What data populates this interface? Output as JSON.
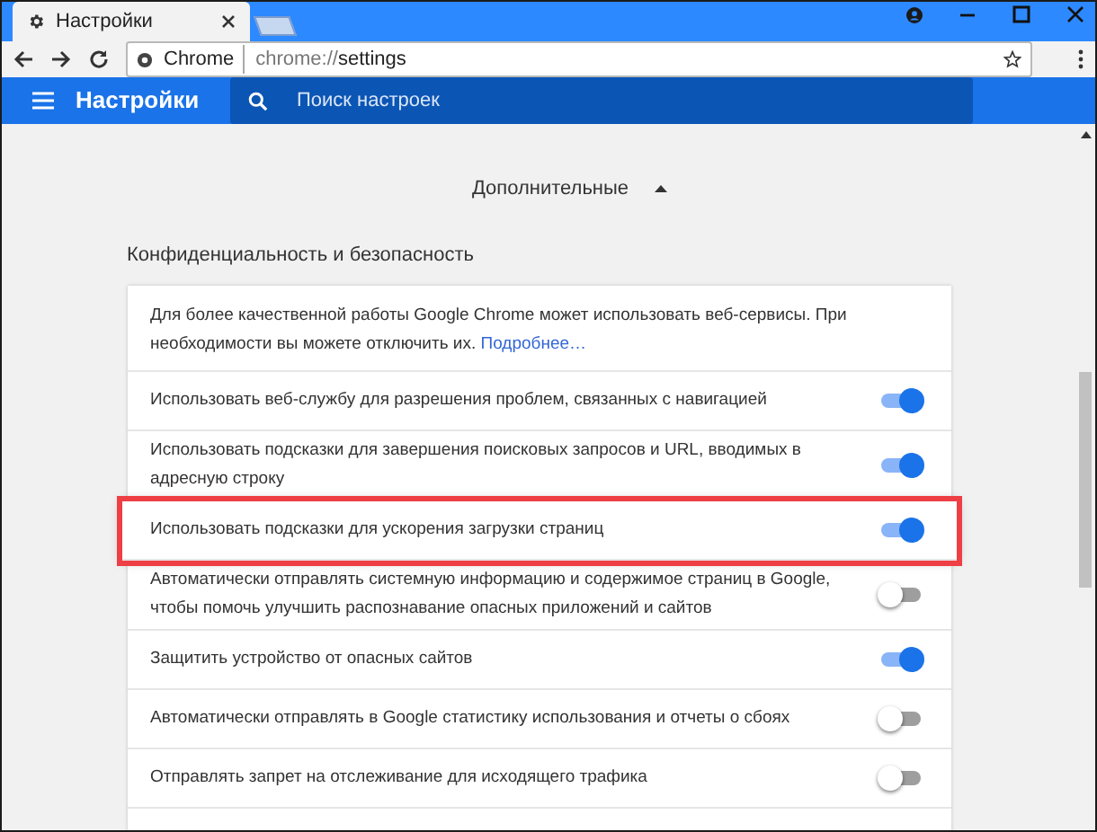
{
  "tab": {
    "title": "Настройки"
  },
  "address_bar": {
    "site": "Chrome",
    "url_prefix": "chrome://",
    "url_path": "settings"
  },
  "header": {
    "title": "Настройки",
    "search": {
      "placeholder": "Поиск настроек"
    }
  },
  "advanced": {
    "label": "Дополнительные",
    "expanded": true
  },
  "section_title": "Конфиденциальность и безопасность",
  "intro": {
    "text": "Для более качественной работы Google Chrome может использовать веб-сервисы. При необходимости вы можете отключить их.",
    "link": "Подробнее…"
  },
  "settings": [
    {
      "label": "Использовать веб-службу для разрешения проблем, связанных с навигацией",
      "on": true,
      "highlighted": false
    },
    {
      "label": "Использовать подсказки для завершения поисковых запросов и URL, вводимых в адресную строку",
      "on": true,
      "highlighted": false
    },
    {
      "label": "Использовать подсказки для ускорения загрузки страниц",
      "on": true,
      "highlighted": true
    },
    {
      "label": "Автоматически отправлять системную информацию и содержимое страниц в Google, чтобы помочь улучшить распознавание опасных приложений и сайтов",
      "on": false,
      "highlighted": false
    },
    {
      "label": "Защитить устройство от опасных сайтов",
      "on": true,
      "highlighted": false
    },
    {
      "label": "Автоматически отправлять в Google статистику использования и отчеты о сбоях",
      "on": false,
      "highlighted": false
    },
    {
      "label": "Отправлять запрет на отслеживание для исходящего трафика",
      "on": false,
      "highlighted": false
    }
  ]
}
